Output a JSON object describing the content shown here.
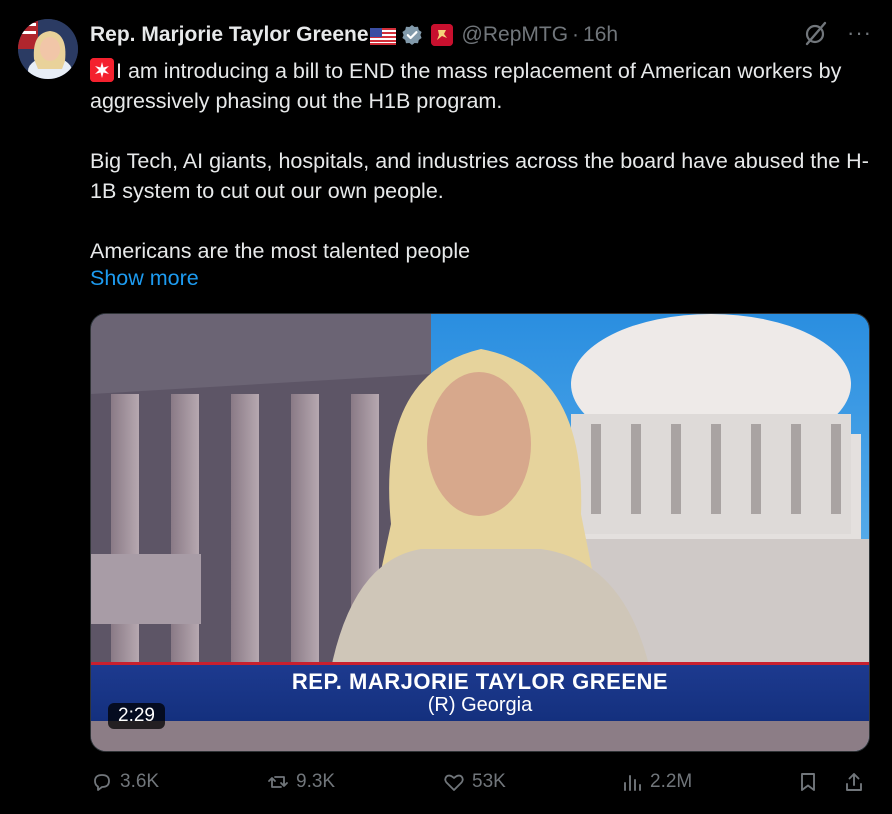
{
  "tweet": {
    "author_name": "Rep. Marjorie Taylor Greene",
    "handle": "@RepMTG",
    "separator": "·",
    "time": "16h",
    "more_label": "···",
    "paragraphs": [
      "I am introducing a bill to END the mass replacement of American workers by aggressively phasing out the H1B program.",
      "Big Tech, AI giants, hospitals, and industries across the board have abused the H-1B system to cut out our own people.",
      "Americans are the most talented people"
    ],
    "show_more": "Show more"
  },
  "video": {
    "lower_third_name": "REP. MARJORIE TAYLOR GREENE",
    "lower_third_sub": "(R) Georgia",
    "duration": "2:29"
  },
  "actions": {
    "replies": "3.6K",
    "reposts": "9.3K",
    "likes": "53K",
    "views": "2.2M"
  },
  "colors": {
    "background": "#000000",
    "text": "#e7e9ea",
    "secondary": "#71767b",
    "link": "#1d9bf0",
    "lower_third_blue": "#1d3a8f",
    "lower_third_red": "#c8202e"
  },
  "icons": [
    "flag-usa-icon",
    "verified-badge-icon",
    "affiliate-badge-icon",
    "grok-icon",
    "siren-emoji-icon",
    "reply-icon",
    "repost-icon",
    "like-icon",
    "views-icon",
    "bookmark-icon",
    "share-icon"
  ]
}
